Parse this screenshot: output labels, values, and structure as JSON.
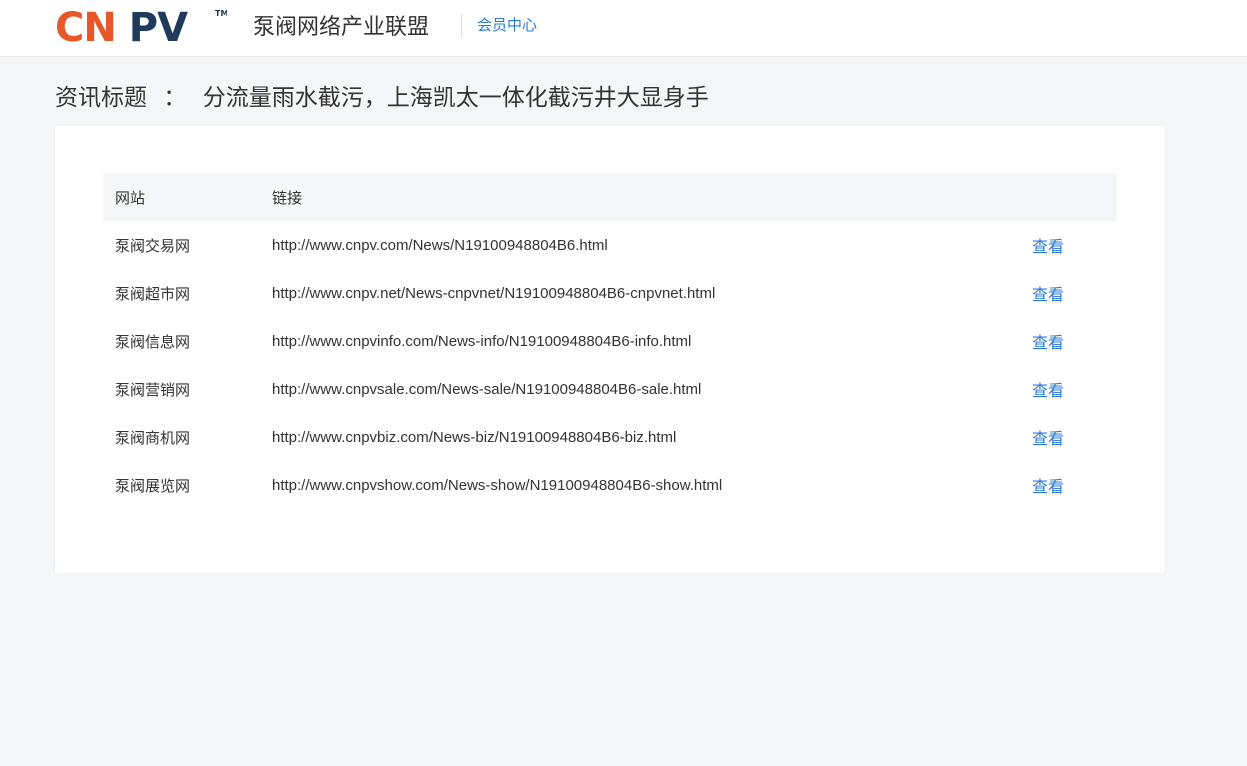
{
  "header": {
    "logo_text": "CNPV",
    "logo_tm": "TM",
    "site_name": "泵阀网络产业联盟",
    "member_center": "会员中心"
  },
  "page": {
    "title_label": "资讯标题",
    "title_sep": "：",
    "title_text": "分流量雨水截污，上海凯太一体化截污井大显身手"
  },
  "table": {
    "headers": [
      "网站",
      "链接",
      ""
    ],
    "rows": [
      {
        "site": "泵阀交易网",
        "url": "http://www.cnpv.com/News/N19100948804B6.html",
        "action": "查看"
      },
      {
        "site": "泵阀超市网",
        "url": "http://www.cnpv.net/News-cnpvnet/N19100948804B6-cnpvnet.html",
        "action": "查看"
      },
      {
        "site": "泵阀信息网",
        "url": "http://www.cnpvinfo.com/News-info/N19100948804B6-info.html",
        "action": "查看"
      },
      {
        "site": "泵阀营销网",
        "url": "http://www.cnpvsale.com/News-sale/N19100948804B6-sale.html",
        "action": "查看"
      },
      {
        "site": "泵阀商机网",
        "url": "http://www.cnpvbiz.com/News-biz/N19100948804B6-biz.html",
        "action": "查看"
      },
      {
        "site": "泵阀展览网",
        "url": "http://www.cnpvshow.com/News-show/N19100948804B6-show.html",
        "action": "查看"
      }
    ]
  },
  "colors": {
    "logo_orange": "#e8562a",
    "logo_navy": "#1f3a5a",
    "link_blue": "#2a7bd0"
  }
}
